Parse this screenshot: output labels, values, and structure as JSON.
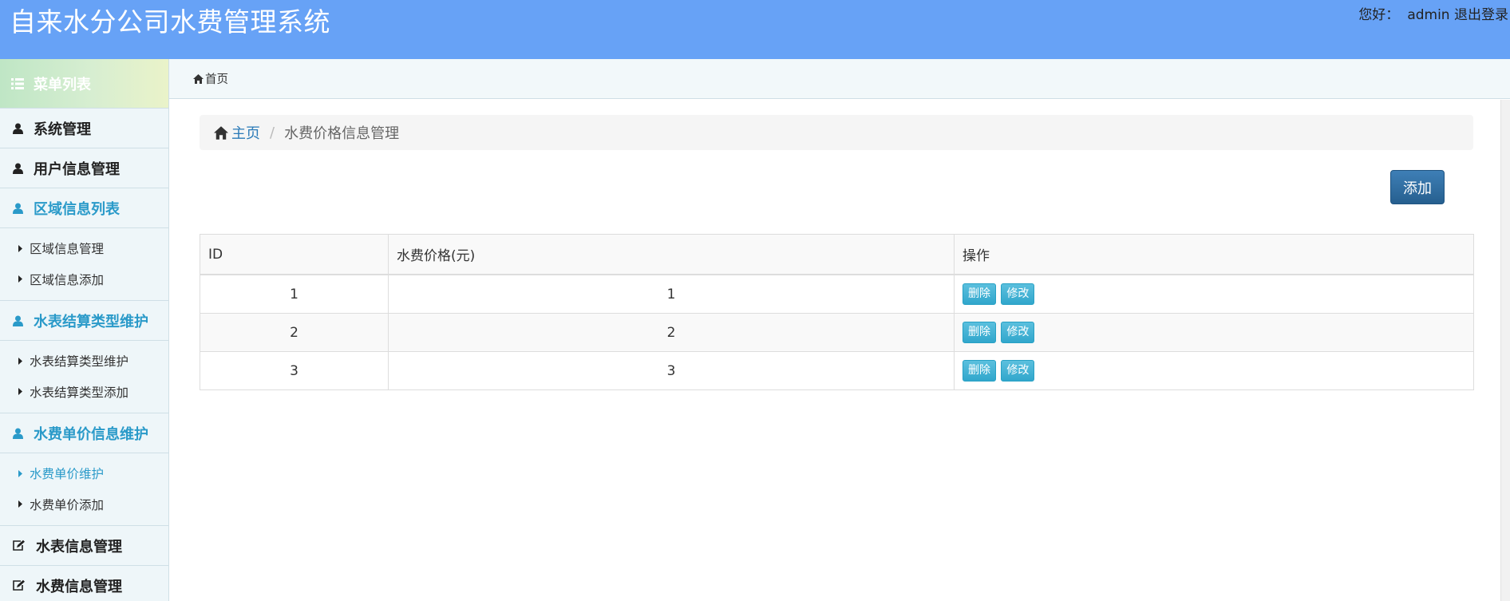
{
  "header": {
    "title": "自来水分公司水费管理系统",
    "greeting": "您好：",
    "username": "admin",
    "logout_label": "退出登录"
  },
  "sidebar": {
    "title": "菜单列表",
    "groups": [
      {
        "label": "系统管理",
        "icon": "user-icon"
      },
      {
        "label": "用户信息管理",
        "icon": "user-icon"
      },
      {
        "label": "区域信息列表",
        "icon": "user-icon",
        "items": [
          "区域信息管理",
          "区域信息添加"
        ]
      },
      {
        "label": "水表结算类型维护",
        "icon": "user-icon",
        "items": [
          "水表结算类型维护",
          "水表结算类型添加"
        ]
      },
      {
        "label": "水费单价信息维护",
        "icon": "user-icon",
        "items": [
          "水费单价维护",
          "水费单价添加"
        ]
      },
      {
        "label": "水表信息管理",
        "icon": "edit-icon"
      },
      {
        "label": "水费信息管理",
        "icon": "edit-icon"
      }
    ]
  },
  "topnav": {
    "home_label": "首页"
  },
  "breadcrumb": {
    "home": "主页",
    "current": "水费价格信息管理"
  },
  "actions": {
    "add_label": "添加"
  },
  "table": {
    "headers": [
      "ID",
      "水费价格(元)",
      "操作"
    ],
    "rows": [
      {
        "id": "1",
        "price": "1"
      },
      {
        "id": "2",
        "price": "2"
      },
      {
        "id": "3",
        "price": "3"
      }
    ],
    "delete_label": "删除",
    "edit_label": "修改"
  },
  "colors": {
    "header_bg": "#67a2f6",
    "accent": "#2a9ac9",
    "primary_button": "#265f8f",
    "info_button": "#5bc0de"
  }
}
